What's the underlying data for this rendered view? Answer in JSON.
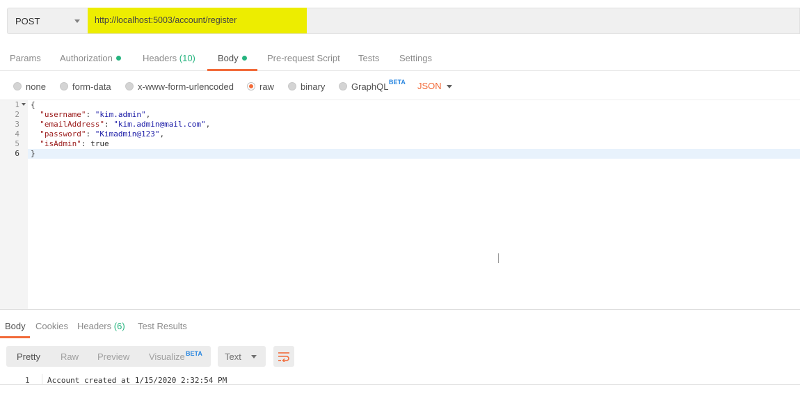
{
  "request": {
    "method": "POST",
    "url": "http://localhost:5003/account/register"
  },
  "tabs": {
    "params": "Params",
    "authorization": "Authorization",
    "headers": "Headers",
    "headers_count": "(10)",
    "body": "Body",
    "prerequest": "Pre-request Script",
    "tests": "Tests",
    "settings": "Settings"
  },
  "body_types": {
    "none": "none",
    "form_data": "form-data",
    "urlencoded": "x-www-form-urlencoded",
    "raw": "raw",
    "binary": "binary",
    "graphql": "GraphQL",
    "beta": "BETA",
    "format": "JSON"
  },
  "editor": {
    "line_numbers": [
      "1",
      "2",
      "3",
      "4",
      "5",
      "6"
    ],
    "lines": {
      "open": "{",
      "k1": "\"username\"",
      "v1": "\"kim.admin\"",
      "k2": "\"emailAddress\"",
      "v2": "\"kim.admin@mail.com\"",
      "k3": "\"password\"",
      "v3": "\"Kimadmin@123\"",
      "k4": "\"isAdmin\"",
      "v4": "true",
      "close": "}"
    }
  },
  "response": {
    "tabs": {
      "body": "Body",
      "cookies": "Cookies",
      "headers": "Headers",
      "headers_count": "(6)",
      "test_results": "Test Results"
    },
    "views": {
      "pretty": "Pretty",
      "raw": "Raw",
      "preview": "Preview",
      "visualize": "Visualize",
      "beta": "BETA"
    },
    "format": "Text",
    "line_number": "1",
    "text": "Account created at 1/15/2020 2:32:54 PM"
  },
  "colors": {
    "accent": "#f26b3a",
    "green": "#26b47f",
    "url_highlight": "#eded00",
    "beta": "#2a87e0"
  }
}
